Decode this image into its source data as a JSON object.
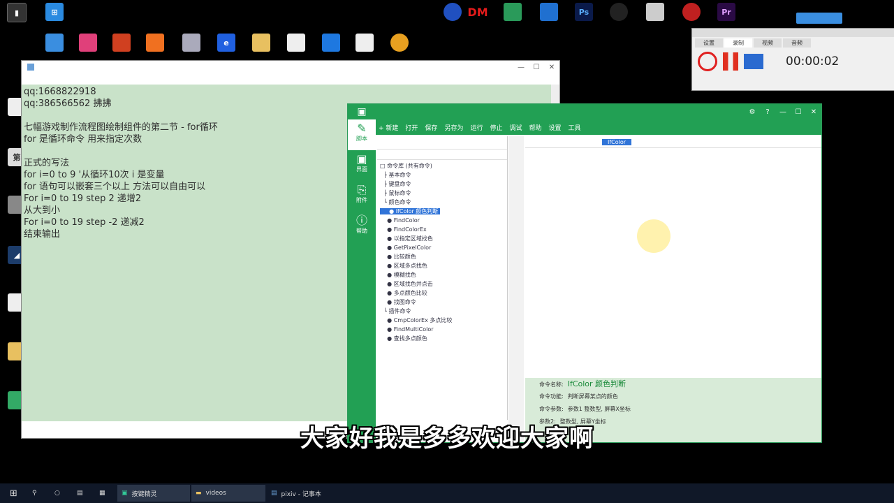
{
  "desktop": {
    "top_icons": [
      {
        "label": "DM",
        "color": "#e31b1b"
      },
      {
        "label": "Ps",
        "color": "#0a1a4a"
      },
      {
        "label": "Pr",
        "color": "#2a0a44"
      }
    ]
  },
  "notepad": {
    "lines": [
      "qq:1668822918",
      "qq:386566562 拂拂",
      "",
      "七幅游戏制作流程图绘制组件的第二节 - for循环",
      "for 是循环命令 用来指定次数",
      "",
      "正式的写法",
      "for i=0 to 9 '从循环10次 i 是变量",
      "for 语句可以嵌套三个以上 方法可以自由可以",
      "For i=0 to 19 step 2 递增2",
      "从大到小",
      "For i=0 to 19 step -2 递减2",
      "结束输出"
    ]
  },
  "ide": {
    "toolbar": [
      "+ 新建",
      "打开",
      "保存",
      "另存为",
      "运行",
      "停止",
      "调试",
      "帮助",
      "设置",
      "工具"
    ],
    "side": [
      {
        "label": "脚本",
        "icon": "✎"
      },
      {
        "label": "界面",
        "icon": "▣"
      },
      {
        "label": "附件",
        "icon": "⎘"
      },
      {
        "label": "帮助",
        "icon": "ⓘ"
      }
    ],
    "tree": [
      "□ 命令库 (共有命令)",
      "  ├ 基本命令",
      "  ├ 键盘命令",
      "  ├ 鼠标命令",
      "  └ 颜色命令",
      "    ● IfColor 颜色判断",
      "    ● FindColor",
      "    ● FindColorEx",
      "    ● 以指定区域找色",
      "    ● GetPixelColor",
      "    ● 比较颜色",
      "    ● 区域多点找色",
      "    ● 模糊找色",
      "    ● 区域找色并点击",
      "    ● 多点颜色比较",
      "    ● 找图命令",
      "  └ 插件命令",
      "    ● CmpColorEx 多点比较",
      "    ● FindMultiColor",
      "    ● 查找多点颜色"
    ],
    "tree_selected_index": 5,
    "editor_tab": "IfColor",
    "bottom": [
      {
        "key": "命令名称:",
        "value": "IfColor 颜色判断"
      },
      {
        "key": "命令功能:",
        "value": "判断屏幕某点的颜色"
      },
      {
        "key": "命令参数:",
        "value": "参数1 整数型, 屏幕X坐标"
      },
      {
        "key": "参数2:",
        "value": "整数型, 屏幕Y坐标"
      }
    ]
  },
  "recorder": {
    "time": "00:00:02",
    "tabs": [
      "设置",
      "录制",
      "视频",
      "音频"
    ],
    "buttons": [
      "开始",
      "暂停",
      "画面"
    ]
  },
  "subtitle": "大家好我是多多欢迎大家啊",
  "taskbar": {
    "apps": [
      "按键精灵",
      "videos",
      "pixiv - 记事本"
    ]
  }
}
